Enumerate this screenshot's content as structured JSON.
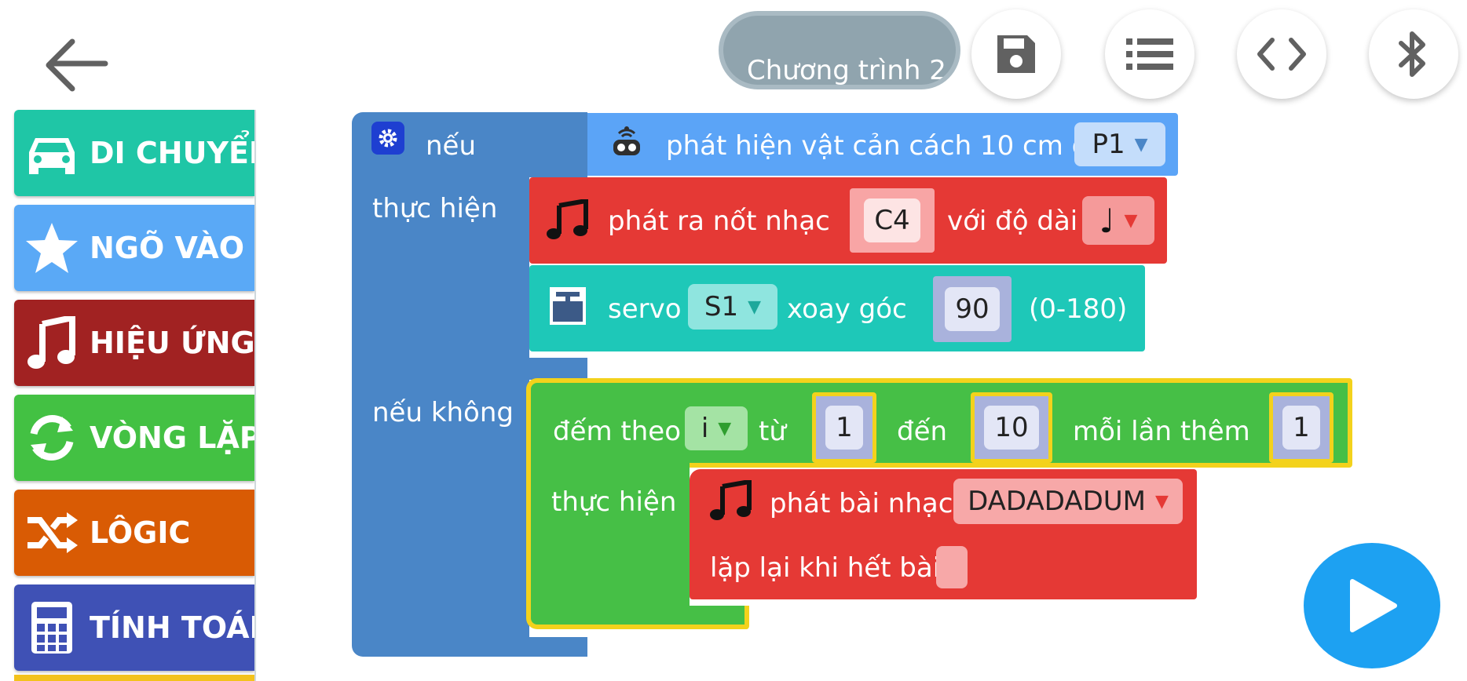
{
  "header": {
    "program_name": "Chương trình 2",
    "icons": [
      "back-arrow-icon",
      "save-icon",
      "list-icon",
      "code-icon",
      "bluetooth-icon"
    ]
  },
  "categories": [
    {
      "label": "DI CHUYỂN",
      "icon": "car-icon",
      "color": "#1fc6a6"
    },
    {
      "label": "NGÕ VÀO",
      "icon": "star-icon",
      "color": "#5aa9f6"
    },
    {
      "label": "HIỆU ỨNG",
      "icon": "music-note-icon",
      "color": "#a12222"
    },
    {
      "label": "VÒNG LẶP",
      "icon": "refresh-icon",
      "color": "#43c143"
    },
    {
      "label": "LÔGIC",
      "icon": "shuffle-icon",
      "color": "#d95b04"
    },
    {
      "label": "TÍNH TOÁN",
      "icon": "calculator-icon",
      "color": "#3f51b5"
    }
  ],
  "if_block": {
    "if_label": "nếu",
    "do_label": "thực hiện",
    "else_label": "nếu không",
    "color": "#4a86c7"
  },
  "sensor_block": {
    "label": "phát hiện vật cản cách 10 cm ở",
    "port": "P1",
    "color": "#5ba4f7"
  },
  "note_block": {
    "label": "phát ra nốt nhạc",
    "note": "C4",
    "duration_label": "với độ dài",
    "duration": "♩",
    "color": "#e53935"
  },
  "servo_block": {
    "label": "servo",
    "port": "S1",
    "rotate_label": "xoay góc",
    "angle": "90",
    "range": "(0-180)",
    "color": "#1ec8b8"
  },
  "loop_block": {
    "count_label": "đếm theo",
    "var": "i",
    "from_label": "từ",
    "from": "1",
    "to_label": "đến",
    "to": "10",
    "step_label": "mỗi lần thêm",
    "step": "1",
    "do_label": "thực hiện",
    "color": "#46bf46",
    "highlight": "#f3d21c"
  },
  "melody_block": {
    "label": "phát bài nhạc",
    "melody": "DADADADUM",
    "repeat_label": "lặp lại khi hết bài",
    "color": "#e53935"
  }
}
